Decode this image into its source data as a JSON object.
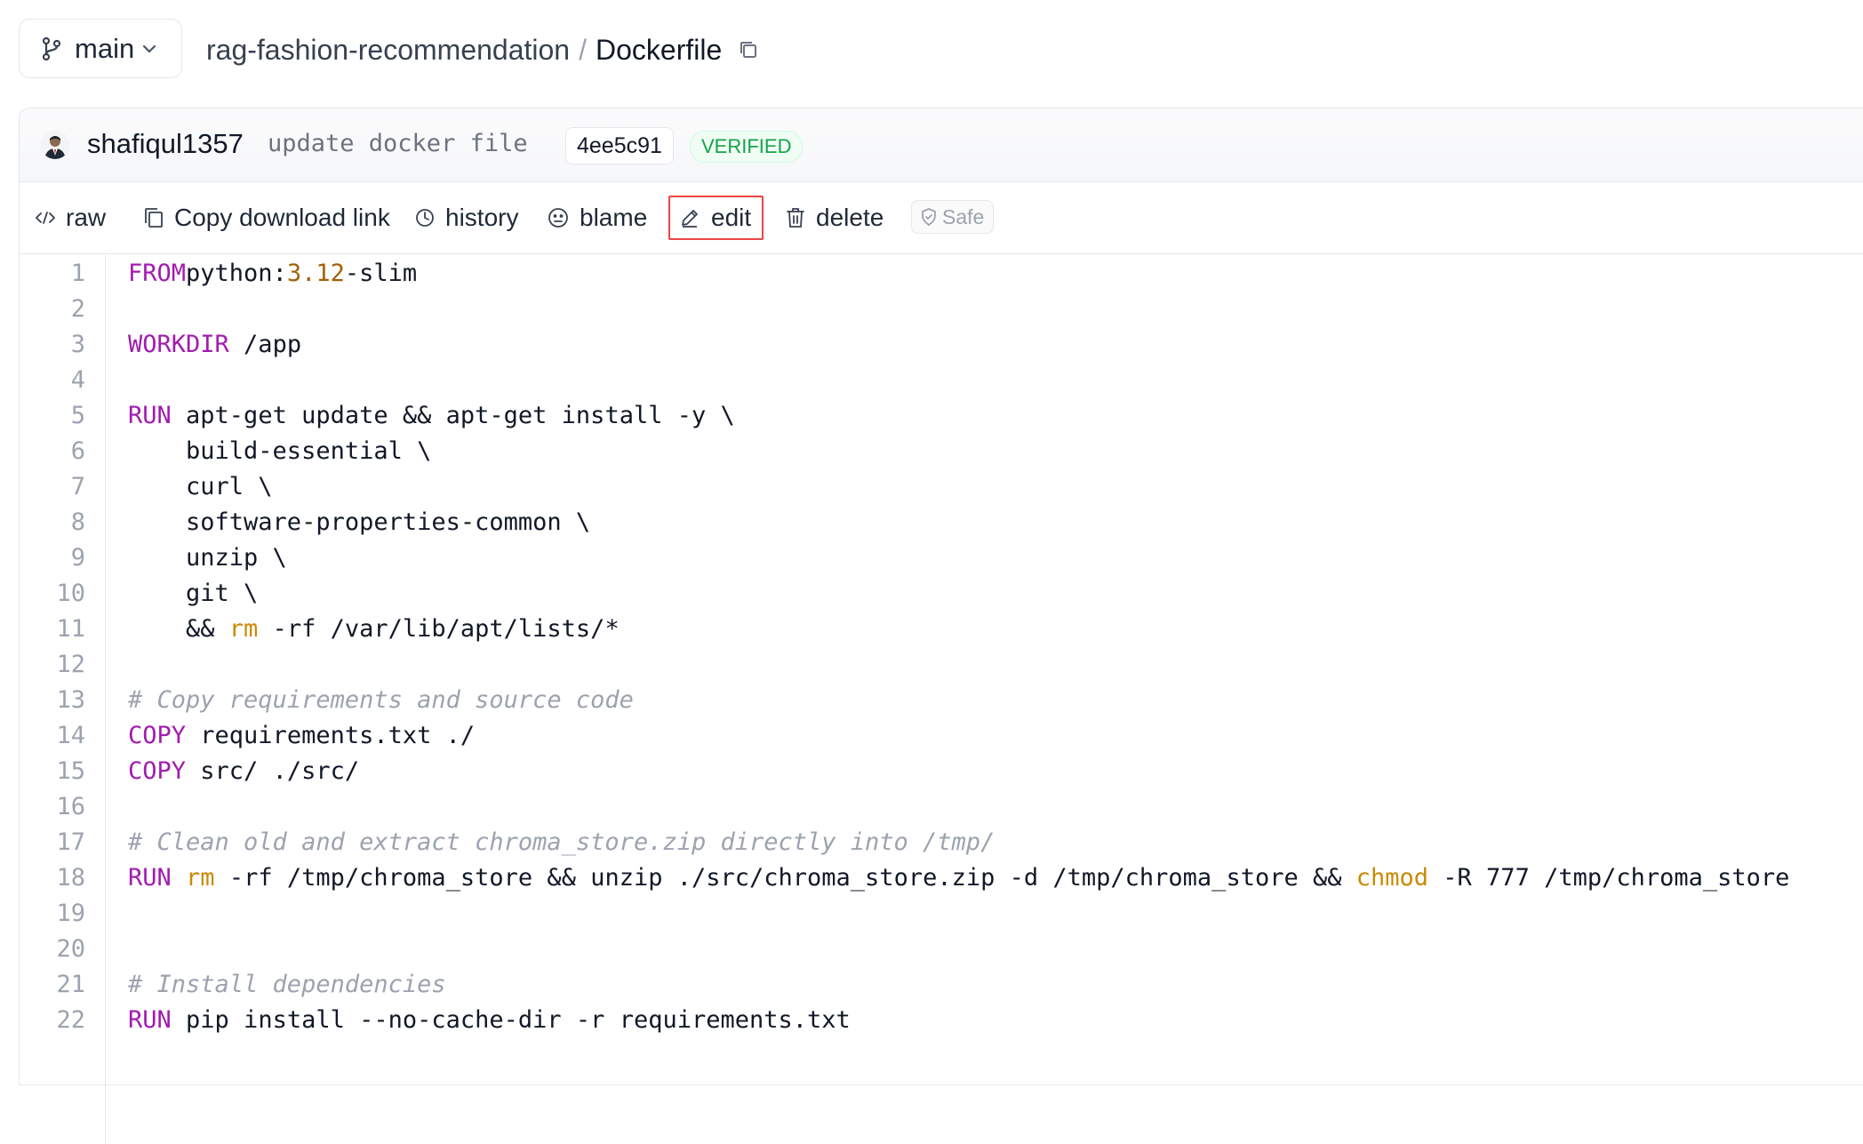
{
  "branch": {
    "name": "main"
  },
  "breadcrumb": {
    "repo": "rag-fashion-recommendation",
    "separator": "/",
    "file": "Dockerfile"
  },
  "commit": {
    "author": "shafiqul1357",
    "message": "update docker file",
    "sha": "4ee5c91",
    "badge": "VERIFIED"
  },
  "actions": {
    "raw": "raw",
    "copy_link": "Copy download link",
    "history": "history",
    "blame": "blame",
    "edit": "edit",
    "delete": "delete",
    "safe": "Safe"
  },
  "colors": {
    "keyword": "#a21caf",
    "number": "#a16207",
    "command": "#ca8a04",
    "comment": "#9ca3af",
    "verified": "#16a34a",
    "edit_highlight": "#ef4444"
  },
  "code": {
    "lines": [
      {
        "n": "1",
        "parts": [
          [
            "kw",
            "FROM"
          ],
          [
            "",
            "python:"
          ],
          [
            "num",
            "3.12"
          ],
          [
            "",
            "-slim"
          ]
        ]
      },
      {
        "n": "2",
        "parts": []
      },
      {
        "n": "3",
        "parts": [
          [
            "kw",
            "WORKDIR"
          ],
          [
            "",
            " /app"
          ]
        ]
      },
      {
        "n": "4",
        "parts": []
      },
      {
        "n": "5",
        "parts": [
          [
            "kw",
            "RUN"
          ],
          [
            "",
            " apt-get update && apt-get install -y \\"
          ]
        ]
      },
      {
        "n": "6",
        "parts": [
          [
            "",
            "    build-essential \\"
          ]
        ]
      },
      {
        "n": "7",
        "parts": [
          [
            "",
            "    curl \\"
          ]
        ]
      },
      {
        "n": "8",
        "parts": [
          [
            "",
            "    software-properties-common \\"
          ]
        ]
      },
      {
        "n": "9",
        "parts": [
          [
            "",
            "    unzip \\"
          ]
        ]
      },
      {
        "n": "10",
        "parts": [
          [
            "",
            "    git \\"
          ]
        ]
      },
      {
        "n": "11",
        "parts": [
          [
            "",
            "    && "
          ],
          [
            "cmd",
            "rm"
          ],
          [
            "",
            " -rf /var/lib/apt/lists/*"
          ]
        ]
      },
      {
        "n": "12",
        "parts": []
      },
      {
        "n": "13",
        "parts": [
          [
            "cm",
            "# Copy requirements and source code"
          ]
        ]
      },
      {
        "n": "14",
        "parts": [
          [
            "kw",
            "COPY"
          ],
          [
            "",
            " requirements.txt ./"
          ]
        ]
      },
      {
        "n": "15",
        "parts": [
          [
            "kw",
            "COPY"
          ],
          [
            "",
            " src/ ./src/"
          ]
        ]
      },
      {
        "n": "16",
        "parts": []
      },
      {
        "n": "17",
        "parts": [
          [
            "cm",
            "# Clean old and extract chroma_store.zip directly into /tmp/"
          ]
        ]
      },
      {
        "n": "18",
        "parts": [
          [
            "kw",
            "RUN"
          ],
          [
            "",
            " "
          ],
          [
            "cmd",
            "rm"
          ],
          [
            "",
            " -rf /tmp/chroma_store && unzip ./src/chroma_store.zip -d /tmp/chroma_store && "
          ],
          [
            "cmd",
            "chmod"
          ],
          [
            "",
            " -R 777 /tmp/chroma_store"
          ]
        ]
      },
      {
        "n": "19",
        "parts": []
      },
      {
        "n": "20",
        "parts": []
      },
      {
        "n": "21",
        "parts": [
          [
            "cm",
            "# Install dependencies"
          ]
        ]
      },
      {
        "n": "22",
        "parts": [
          [
            "kw",
            "RUN"
          ],
          [
            "",
            " pip install --no-cache-dir -r requirements.txt"
          ]
        ]
      }
    ]
  }
}
